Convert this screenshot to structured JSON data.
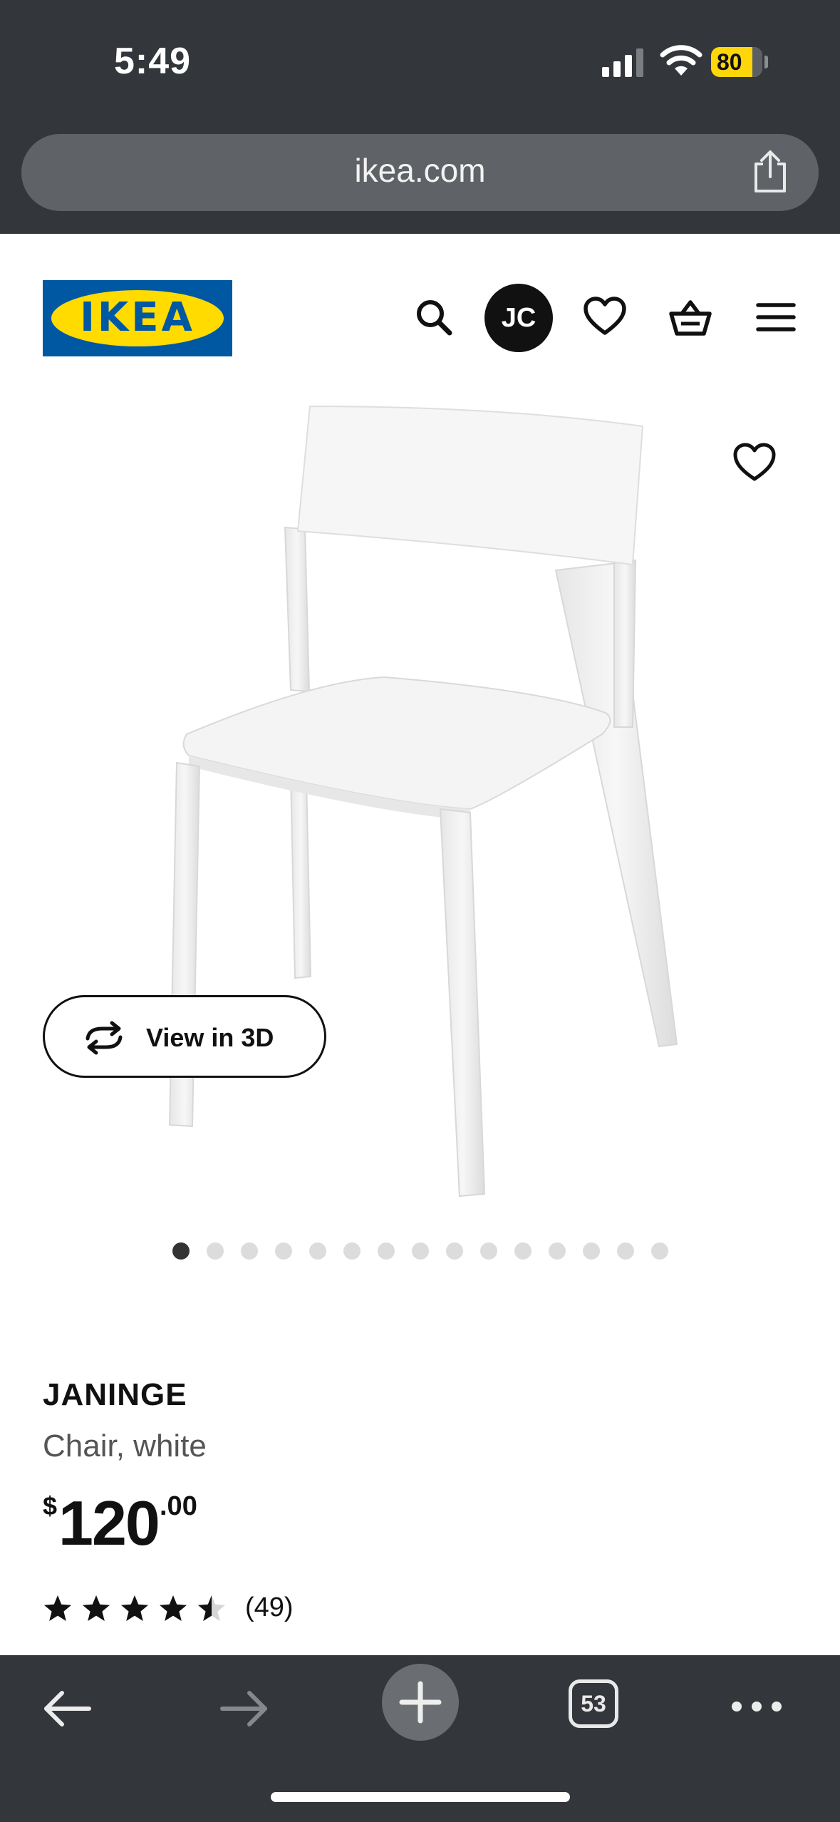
{
  "status_bar": {
    "time": "5:49",
    "battery": "80"
  },
  "browser": {
    "url": "ikea.com"
  },
  "header": {
    "logo_text": "IKEA",
    "avatar_initials": "JC"
  },
  "gallery": {
    "view3d_label": "View in 3D",
    "image_count": 15,
    "active_index": 0
  },
  "product": {
    "name": "JANINGE",
    "description": "Chair, white",
    "price_currency": "$",
    "price_integer": "120",
    "price_decimal": ".00",
    "rating": 4.5,
    "reviews": "(49)"
  },
  "toolbar": {
    "tab_count": "53"
  },
  "colors": {
    "chrome": "#33363b",
    "ikea_blue": "#0058a3",
    "ikea_yellow": "#ffdb00",
    "battery": "#ffd60a"
  }
}
